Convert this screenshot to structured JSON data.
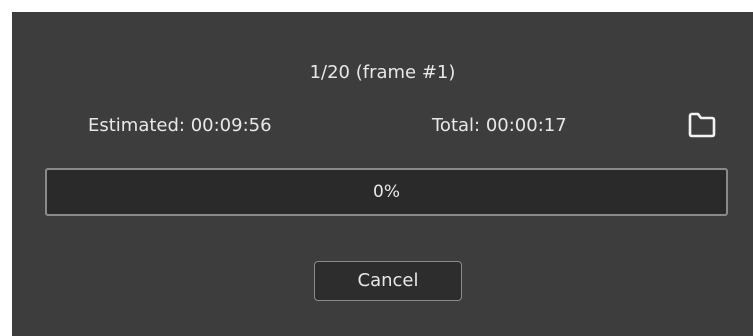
{
  "status": {
    "frame_text": "1/20 (frame #1)",
    "estimated": "Estimated: 00:09:56",
    "total": "Total: 00:00:17"
  },
  "progress": {
    "value": 0,
    "label": "0%",
    "fill_color": "#4a90d9"
  },
  "actions": {
    "open_folder_icon": "folder-icon",
    "cancel_label": "Cancel"
  },
  "colors": {
    "background": "#3d3d3d",
    "text": "#e8e8e8",
    "progress_track": "#2a2a2a",
    "border": "#8a8a8a"
  }
}
